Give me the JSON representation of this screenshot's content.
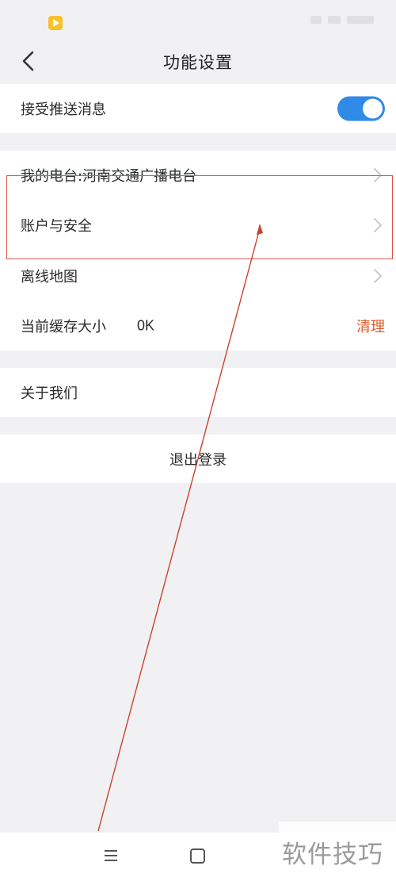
{
  "header": {
    "title": "功能设置"
  },
  "groups": {
    "push": {
      "label": "接受推送消息",
      "toggle_on": true
    },
    "settings": {
      "my_station_label": "我的电台:河南交通广播电台",
      "account_label": "账户与安全",
      "offline_map_label": "离线地图",
      "cache_label": "当前缓存大小",
      "cache_value": "0K",
      "clear_label": "清理"
    },
    "about": {
      "label": "关于我们"
    },
    "logout": {
      "label": "退出登录"
    }
  },
  "watermark": {
    "text": "软件技巧"
  },
  "colors": {
    "accent_blue": "#2f8ae8",
    "clear_orange": "#e05a2a",
    "highlight_red": "#d9544a",
    "background": "#f1f1f4"
  },
  "icons": {
    "back": "chevron-left-icon",
    "row_arrow": "chevron-right-icon",
    "nav_menu": "menu-icon",
    "nav_home": "home-square-icon"
  }
}
